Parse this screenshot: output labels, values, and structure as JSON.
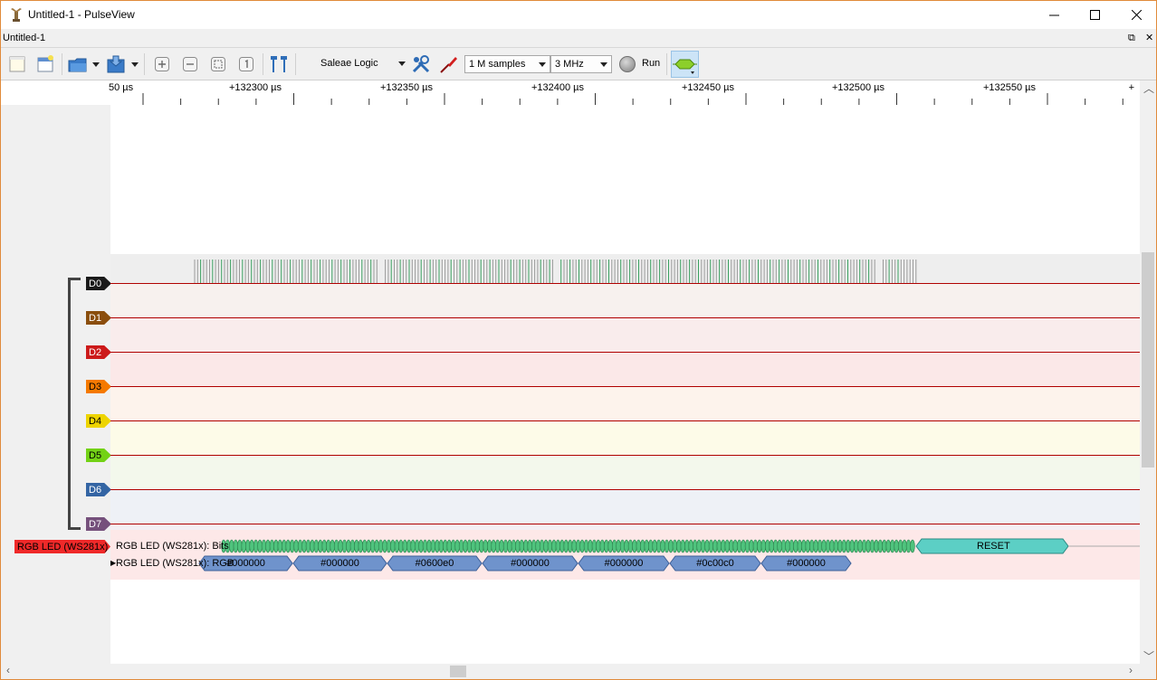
{
  "window": {
    "title": "Untitled-1 - PulseView",
    "minimize_glyph": "—",
    "maximize_glyph": "☐",
    "close_glyph": "✕"
  },
  "tab": {
    "name": "Untitled-1",
    "restore_glyph": "⧉",
    "close_glyph": "✕"
  },
  "toolbar": {
    "device": "Saleae Logic",
    "samples": "1 M samples",
    "rate": "3 MHz",
    "run_label": "Run",
    "icons": [
      "new-session-icon",
      "new-view-icon",
      "open-icon",
      "save-icon",
      "zoom-in-icon",
      "zoom-out-icon",
      "zoom-fit-icon",
      "zoom-one-to-one-icon",
      "cursor-icon",
      "device-settings-icon",
      "probe-icon",
      "add-decoder-icon"
    ]
  },
  "ruler": {
    "ticks": [
      {
        "label": "50 µs",
        "cut": true
      },
      {
        "label": "+132300 µs"
      },
      {
        "label": "+132350 µs"
      },
      {
        "label": "+132400 µs"
      },
      {
        "label": "+132450 µs"
      },
      {
        "label": "+132500 µs"
      },
      {
        "label": "+132550 µs"
      },
      {
        "label": "+"
      }
    ]
  },
  "channels": [
    {
      "name": "D0",
      "color": "#1a1a1a",
      "text": "#ffffff",
      "band": "#f7f1ee"
    },
    {
      "name": "D1",
      "color": "#8a4e0d",
      "text": "#ffffff",
      "band": "#f9ecec"
    },
    {
      "name": "D2",
      "color": "#cc1a1a",
      "text": "#ffffff",
      "band": "#fbe8e8"
    },
    {
      "name": "D3",
      "color": "#f57900",
      "text": "#000000",
      "band": "#fdf3ec"
    },
    {
      "name": "D4",
      "color": "#edd400",
      "text": "#000000",
      "band": "#fdfbe8"
    },
    {
      "name": "D5",
      "color": "#73d216",
      "text": "#000000",
      "band": "#f3f8ec"
    },
    {
      "name": "D6",
      "color": "#3465a4",
      "text": "#ffffff",
      "band": "#eef1f6"
    },
    {
      "name": "D7",
      "color": "#75507b",
      "text": "#ffffff",
      "band": "#f4eff4"
    }
  ],
  "decoder": {
    "name": "RGB LED (WS281x)",
    "color": "#ef2929",
    "row_bits": "RGB LED (WS281x): Bits",
    "row_rgb": "RGB LED (WS281x): RGB",
    "reset_label": "RESET",
    "rgb_values": [
      "#000000",
      "#000000",
      "#0600e0",
      "#000000",
      "#000000",
      "#0c00c0",
      "#000000"
    ]
  }
}
